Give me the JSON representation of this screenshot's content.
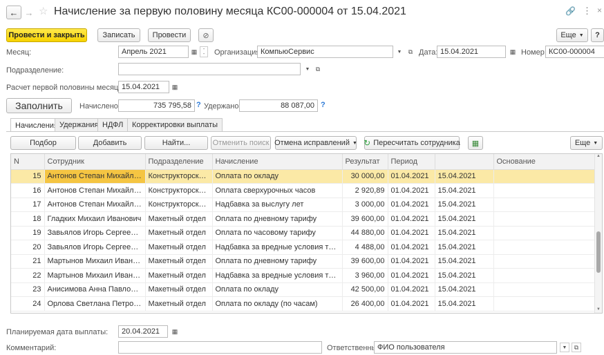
{
  "title": "Начисление за первую половину месяца КС00-000004 от 15.04.2021",
  "toolbar": {
    "post_close": "Провести и закрыть",
    "save": "Записать",
    "post": "Провести",
    "more": "Еще",
    "help": "?"
  },
  "header": {
    "month_label": "Месяц:",
    "month_value": "Апрель 2021",
    "org_label": "Организация:",
    "org_value": "КомпьюСервис",
    "date_label": "Дата:",
    "date_value": "15.04.2021",
    "number_label": "Номер:",
    "number_value": "КС00-000004",
    "division_label": "Подразделение:",
    "division_value": "",
    "calc_until_label": "Расчет первой половины месяца до:",
    "calc_until_value": "15.04.2021"
  },
  "fill": {
    "button": "Заполнить",
    "accrued_label": "Начислено:",
    "accrued_value": "735 795,58",
    "withheld_label": "Удержано:",
    "withheld_value": "88 087,00",
    "q1": "?",
    "q2": "?"
  },
  "tabs": [
    "Начисления",
    "Удержания",
    "НДФЛ",
    "Корректировки выплаты"
  ],
  "grid_toolbar": {
    "select": "Подбор",
    "add": "Добавить",
    "find": "Найти...",
    "cancel_search": "Отменить поиск",
    "cancel_fixes": "Отмена исправлений",
    "recalc": "Пересчитать сотрудника",
    "more": "Еще"
  },
  "columns": [
    "N",
    "Сотрудник",
    "Подразделение",
    "Начисление",
    "Результат",
    "Период",
    "",
    "Основание"
  ],
  "rows": [
    {
      "n": "15",
      "emp": "Антонов Степан Михайлович",
      "div": "Конструкторский ...",
      "acc": "Оплата по окладу",
      "res": "30 000,00",
      "p1": "01.04.2021",
      "p2": "15.04.2021"
    },
    {
      "n": "16",
      "emp": "Антонов Степан Михайлович",
      "div": "Конструкторский ...",
      "acc": "Оплата сверхурочных часов",
      "res": "2 920,89",
      "p1": "01.04.2021",
      "p2": "15.04.2021"
    },
    {
      "n": "17",
      "emp": "Антонов Степан Михайлович",
      "div": "Конструкторский ...",
      "acc": "Надбавка за выслугу лет",
      "res": "3 000,00",
      "p1": "01.04.2021",
      "p2": "15.04.2021"
    },
    {
      "n": "18",
      "emp": "Гладких Михаил Иванович",
      "div": "Макетный отдел",
      "acc": "Оплата по дневному тарифу",
      "res": "39 600,00",
      "p1": "01.04.2021",
      "p2": "15.04.2021"
    },
    {
      "n": "19",
      "emp": "Завьялов Игорь Сергеевич",
      "div": "Макетный отдел",
      "acc": "Оплата по часовому тарифу",
      "res": "44 880,00",
      "p1": "01.04.2021",
      "p2": "15.04.2021"
    },
    {
      "n": "20",
      "emp": "Завьялов Игорь Сергеевич",
      "div": "Макетный отдел",
      "acc": "Надбавка за вредные условия труда",
      "res": "4 488,00",
      "p1": "01.04.2021",
      "p2": "15.04.2021"
    },
    {
      "n": "21",
      "emp": "Мартынов Михаил Иванович",
      "div": "Макетный отдел",
      "acc": "Оплата по дневному тарифу",
      "res": "39 600,00",
      "p1": "01.04.2021",
      "p2": "15.04.2021"
    },
    {
      "n": "22",
      "emp": "Мартынов Михаил Иванович",
      "div": "Макетный отдел",
      "acc": "Надбавка за вредные условия труда",
      "res": "3 960,00",
      "p1": "01.04.2021",
      "p2": "15.04.2021"
    },
    {
      "n": "23",
      "emp": "Анисимова Анна Павловна",
      "div": "Макетный отдел",
      "acc": "Оплата по окладу",
      "res": "42 500,00",
      "p1": "01.04.2021",
      "p2": "15.04.2021"
    },
    {
      "n": "24",
      "emp": "Орлова Светлана Петровна",
      "div": "Макетный отдел",
      "acc": "Оплата по окладу (по часам)",
      "res": "26 400,00",
      "p1": "01.04.2021",
      "p2": "15.04.2021"
    }
  ],
  "footer": {
    "pay_date_label": "Планируемая дата выплаты:",
    "pay_date_value": "20.04.2021",
    "comment_label": "Комментарий:",
    "comment_value": "",
    "responsible_label": "Ответственный:",
    "responsible_value": "ФИО пользователя"
  }
}
